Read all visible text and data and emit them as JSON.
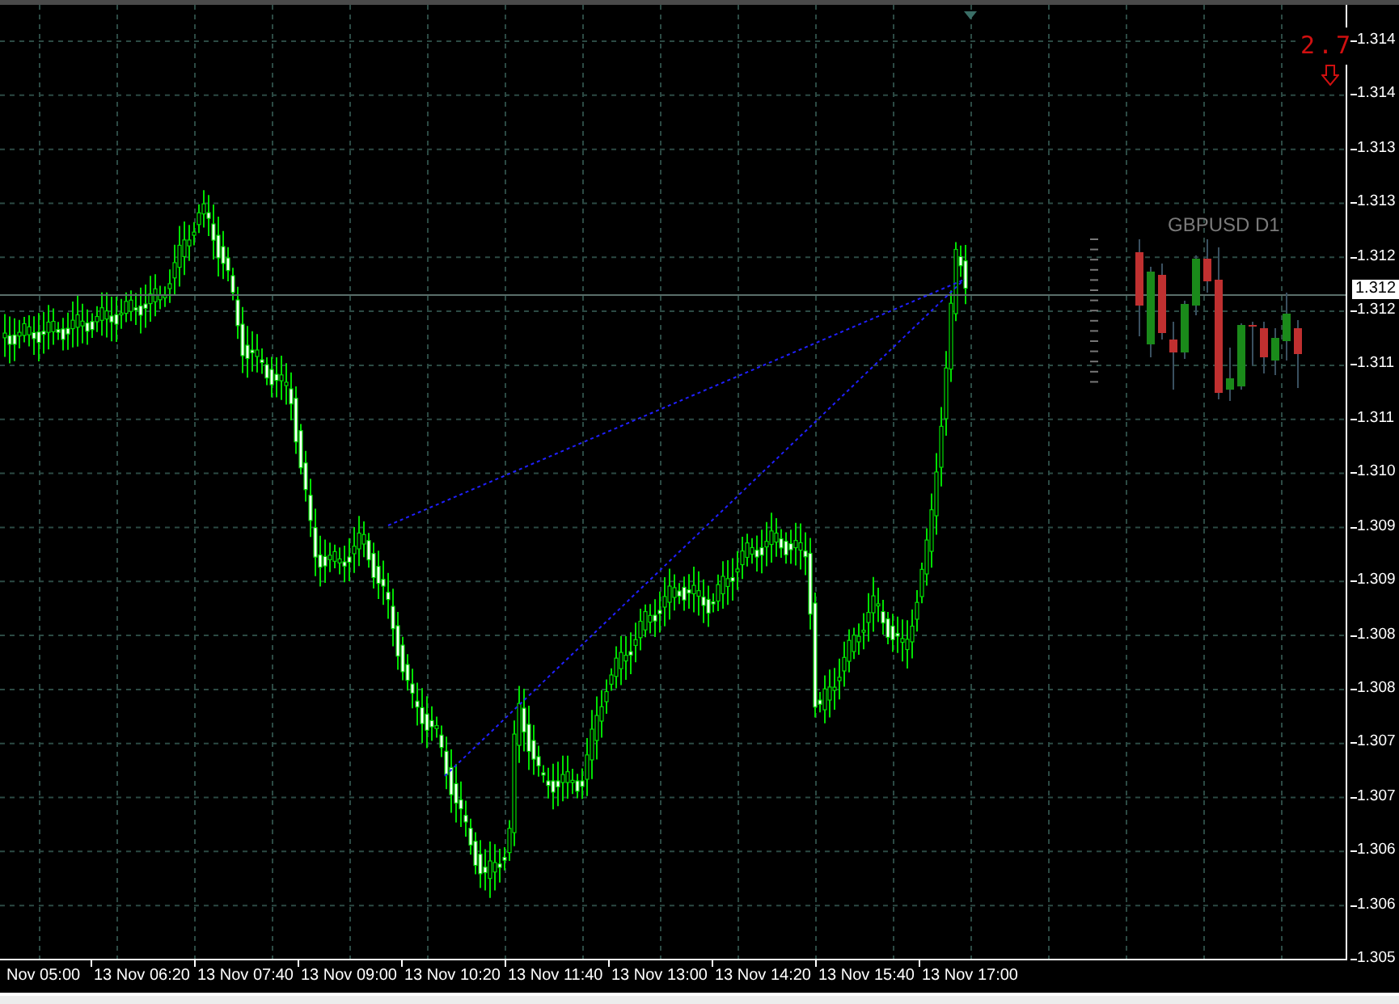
{
  "chart": {
    "symbol_label": "GBPUSD D1",
    "indicator_value": "2.7",
    "current_price": "1.312",
    "price_axis": [
      "1.314",
      "1.314",
      "1.313",
      "1.313",
      "1.312",
      "1.312",
      "1.311",
      "1.311",
      "1.310",
      "1.309",
      "1.309",
      "1.308",
      "1.308",
      "1.307",
      "1.307",
      "1.306",
      "1.306",
      "1.305"
    ],
    "time_axis": [
      "Nov 05:00",
      "13 Nov 06:20",
      "13 Nov 07:40",
      "13 Nov 09:00",
      "13 Nov 10:20",
      "13 Nov 11:40",
      "13 Nov 13:00",
      "13 Nov 14:20",
      "13 Nov 15:40",
      "13 Nov 17:00"
    ]
  }
}
